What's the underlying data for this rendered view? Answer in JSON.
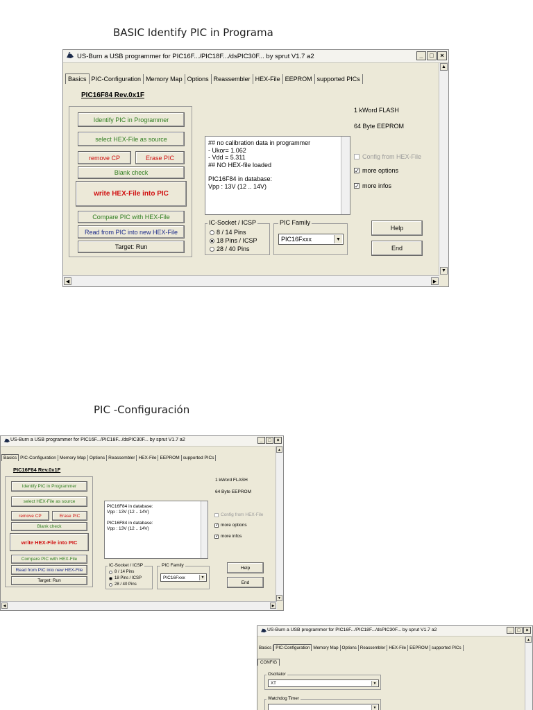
{
  "headings": {
    "first": "BASIC  Identify PIC in Programa",
    "second": "PIC -Configuración"
  },
  "window_title": "US-Burn  a USB programmer for PIC16F.../PIC18F.../dsPIC30F...  by sprut V1.7 a2",
  "window_controls": {
    "minimize": "_",
    "maximize": "□",
    "close": "×"
  },
  "tabs": [
    "Basics",
    "PIC-Configuration",
    "Memory Map",
    "Options",
    "Reassembler",
    "HEX-File",
    "EEPROM",
    "supported PICs"
  ],
  "device": "PIC16F84    Rev.0x1F",
  "buttons": {
    "identify": "Identify PIC in Programmer",
    "select_hex": "select HEX-File as source",
    "remove_cp": "remove CP",
    "erase": "Erase PIC",
    "blank_check": "Blank check",
    "write": "write HEX-File into PIC",
    "compare": "Compare PIC with HEX-File",
    "read": "Read from PIC into new HEX-File",
    "target": "Target: Run",
    "help": "Help",
    "end": "End"
  },
  "log_main": [
    "## no calibration data in programmer",
    "- Ukor= 1.062",
    "- Vdd = 5.311",
    "## NO HEX-file loaded",
    "",
    "PIC16F84 in database:",
    "  Vpp : 13V  (12 .. 14V)"
  ],
  "log_second": [
    "PIC16F84 in database:",
    "  Vpp : 13V  (12 .. 14V)",
    "",
    "PIC16F84 in database:",
    "  Vpp : 13V  (12 .. 14V)"
  ],
  "socket": {
    "label": "IC-Socket / ICSP",
    "options": [
      "8 / 14 Pins",
      "18 Pins / ICSP",
      "28 / 40 Pins"
    ]
  },
  "family": {
    "label": "PIC Family",
    "value": "PIC16Fxxx"
  },
  "memory_info": {
    "flash": "1 kWord FLASH",
    "eeprom": "64 Byte EEPROM"
  },
  "checkboxes": {
    "config_from_hex": "Config from HEX-File",
    "more_options": "more options",
    "more_infos": "more infos"
  },
  "config_window": {
    "subtab": "CONFIG",
    "oscillator_label": "Oscillator",
    "oscillator_value": "XT",
    "watchdog_label": "Watchdog Timer"
  },
  "colors": {
    "window_bg": "#ece9d8",
    "green_text": "#2f7d1f",
    "red_text": "#d01010",
    "blue_text": "#1a2a8a"
  }
}
